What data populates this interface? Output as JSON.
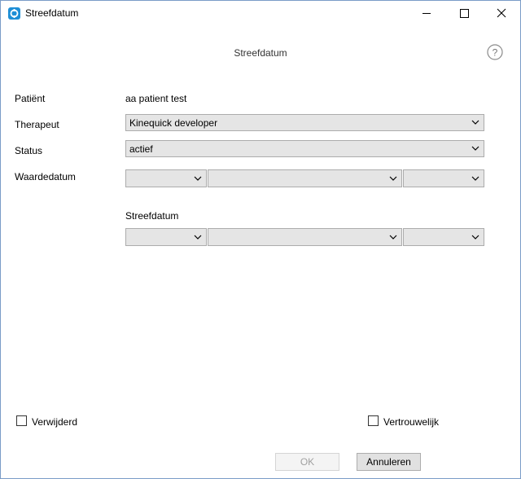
{
  "window": {
    "title": "Streefdatum",
    "controls": [
      "minimize-icon",
      "maximize-icon",
      "close-icon"
    ]
  },
  "header": {
    "title": "Streefdatum",
    "help_icon": "?"
  },
  "form": {
    "patient": {
      "label": "Patiënt",
      "value": "aa patient test"
    },
    "therapeut": {
      "label": "Therapeut",
      "value": "Kinequick developer"
    },
    "status": {
      "label": "Status",
      "value": "actief"
    },
    "waardedatum": {
      "label": "Waardedatum",
      "day": "",
      "month": "",
      "year": ""
    },
    "streefdatum": {
      "label": "Streefdatum",
      "day": "",
      "month": "",
      "year": ""
    }
  },
  "footer": {
    "verwijderd_label": "Verwijderd",
    "verwijderd_checked": false,
    "vertrouwelijk_label": "Vertrouwelijk",
    "vertrouwelijk_checked": false,
    "ok_label": "OK",
    "ok_enabled": false,
    "cancel_label": "Annuleren"
  },
  "colors": {
    "window_border": "#7a9cc7",
    "app_icon": "#1f8fd6",
    "combo_bg": "#e5e5e5"
  }
}
